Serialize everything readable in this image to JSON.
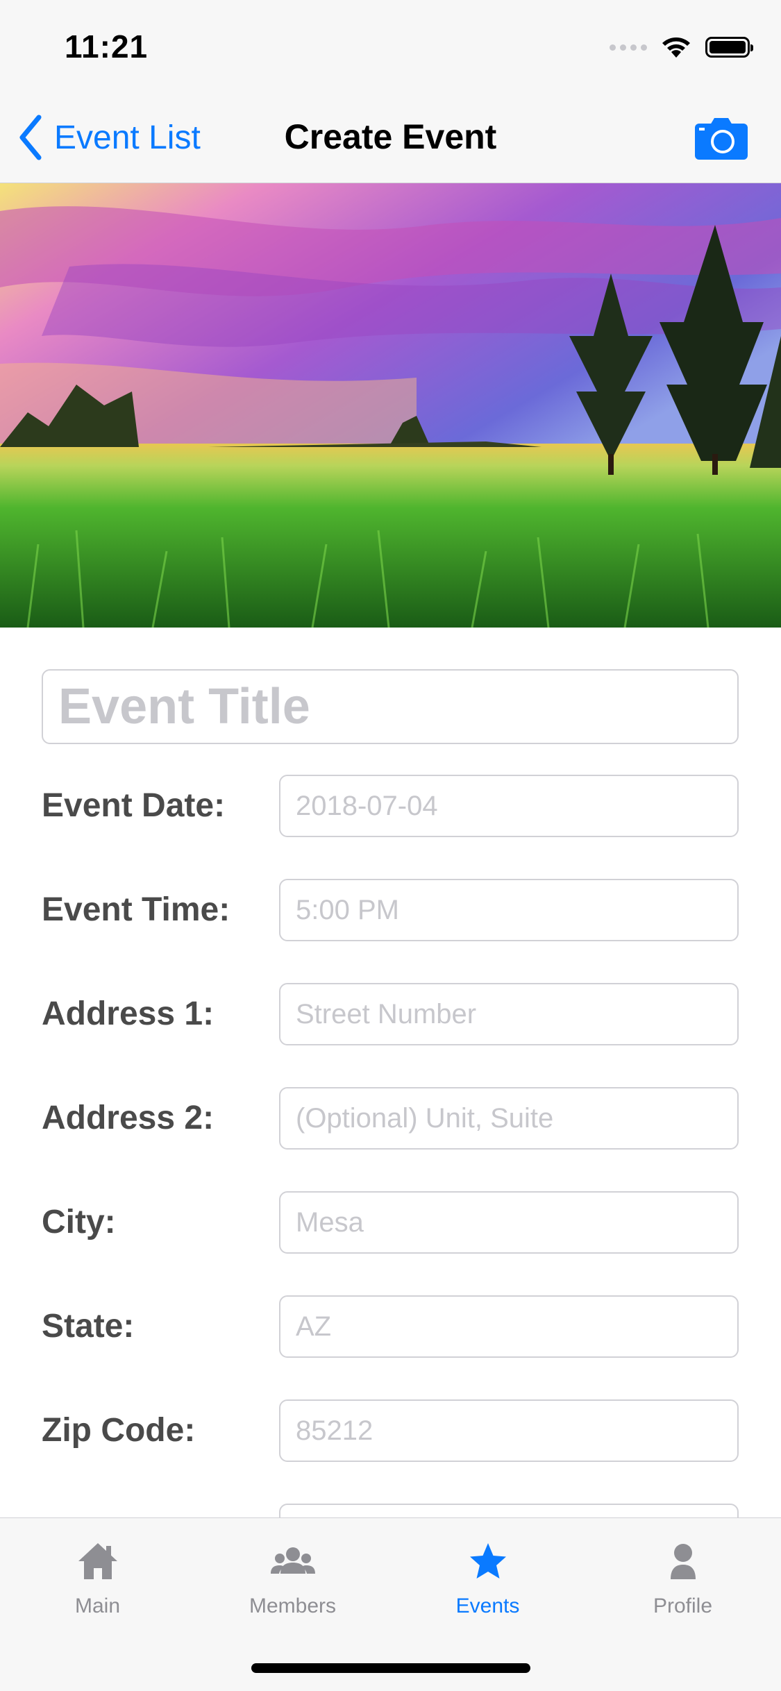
{
  "status_bar": {
    "time": "11:21"
  },
  "nav": {
    "back_label": "Event List",
    "title": "Create Event",
    "accent_color": "#0a7aff"
  },
  "hero": {
    "alt": "Sunset over a green meadow with pine trees"
  },
  "form": {
    "title_placeholder": "Event Title",
    "fields": [
      {
        "label": "Event Date:",
        "placeholder": "2018-07-04"
      },
      {
        "label": "Event Time:",
        "placeholder": "5:00 PM"
      },
      {
        "label": "Address 1:",
        "placeholder": "Street Number"
      },
      {
        "label": "Address 2:",
        "placeholder": "(Optional) Unit, Suite"
      },
      {
        "label": "City:",
        "placeholder": "Mesa"
      },
      {
        "label": "State:",
        "placeholder": "AZ"
      },
      {
        "label": "Zip Code:",
        "placeholder": "85212"
      }
    ]
  },
  "tabs": [
    {
      "label": "Main",
      "icon": "home-icon",
      "active": false
    },
    {
      "label": "Members",
      "icon": "members-icon",
      "active": false
    },
    {
      "label": "Events",
      "icon": "star-icon",
      "active": true
    },
    {
      "label": "Profile",
      "icon": "profile-icon",
      "active": false
    }
  ],
  "colors": {
    "active_tab": "#0a7aff",
    "inactive_tab": "#8e8e93"
  }
}
